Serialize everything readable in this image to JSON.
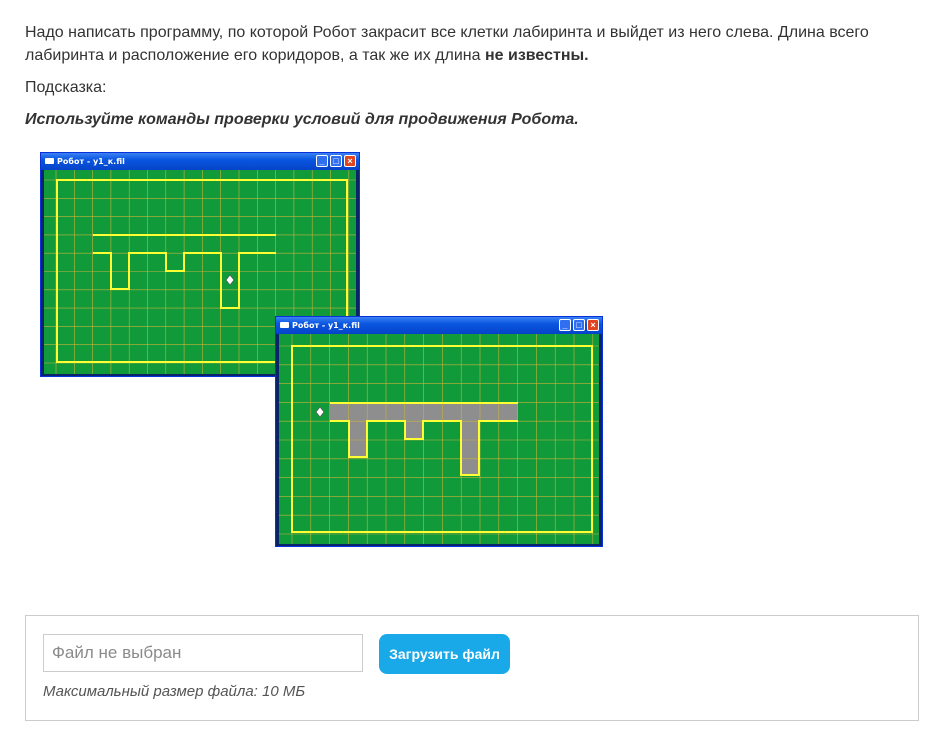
{
  "task": {
    "text_part1": "Надо написать программу, по которой Робот закрасит все клетки лабиринта и выйдет из него слева. Длина всего лабиринта и расположение его коридоров, а так же  их длина ",
    "text_bold": "не известны.",
    "hint_label": "Подсказка:",
    "hint_text": "Используйте команды проверки условий для продвижения Робота."
  },
  "windows": [
    {
      "title": "Робот - y1_к.fil"
    },
    {
      "title": "Робот - y1_к.fil"
    }
  ],
  "robot_field": {
    "colors": {
      "field": "#109a39",
      "grid": "#c9b23c",
      "wall": "#ffff33",
      "painted": "#8e8e8e",
      "robot": "#ffffff"
    }
  },
  "upload": {
    "file_placeholder": "Файл не выбран",
    "button_label": "Загрузить файл",
    "max_size": "Максимальный размер файла: 10 МБ"
  },
  "colors": {
    "accent": "#1aa9e8",
    "titlebar": "#0a56e0"
  }
}
